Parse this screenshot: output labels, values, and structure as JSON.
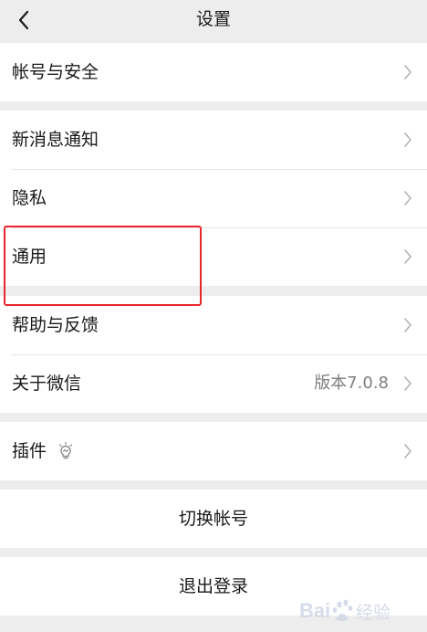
{
  "header": {
    "title": "设置"
  },
  "groups": {
    "account": {
      "label": "帐号与安全"
    },
    "notifications": {
      "new_message_label": "新消息通知",
      "privacy_label": "隐私",
      "general_label": "通用"
    },
    "help": {
      "help_label": "帮助与反馈",
      "about_label": "关于微信",
      "version_value": "版本7.0.8"
    },
    "plugins": {
      "label": "插件"
    }
  },
  "actions": {
    "switch_account": "切换帐号",
    "logout": "退出登录"
  },
  "watermark": {
    "text": "Bai百度经验"
  },
  "colors": {
    "background": "#ededed",
    "card": "#ffffff",
    "highlight": "#e8262c",
    "secondary_text": "#7f7f7f"
  }
}
